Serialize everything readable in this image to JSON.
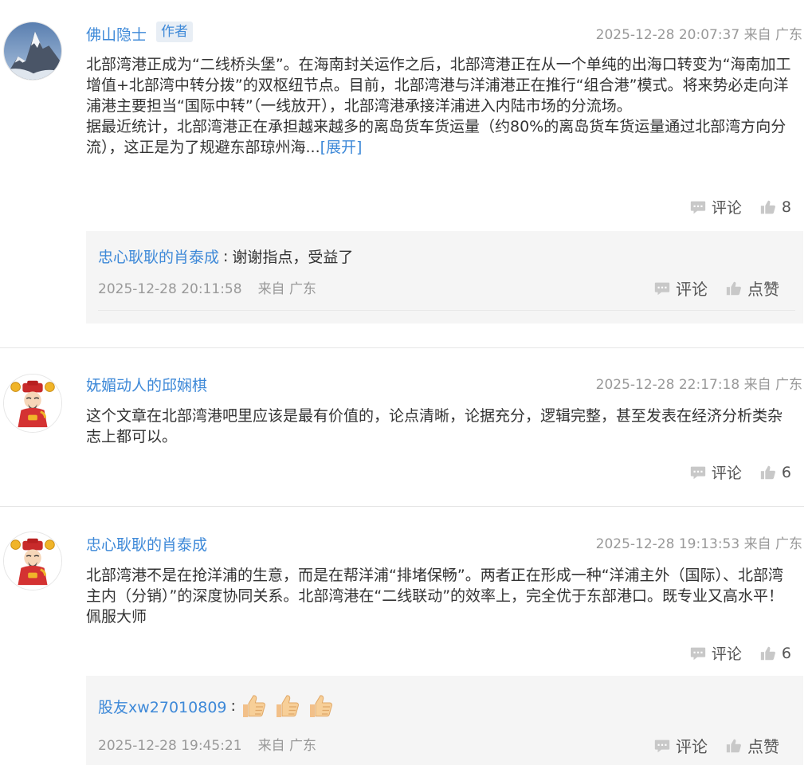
{
  "colors": {
    "link": "#3e89d8",
    "meta": "#999999",
    "reply_bg": "#f5f5f5",
    "icon_grey": "#c8c8c8"
  },
  "comments": [
    {
      "username": "佛山隐士",
      "badge": "作者",
      "timestamp": "2025-12-28 20:07:37 来自 广东",
      "body": "北部湾港正成为“二线桥头堡”。在海南封关运作之后，北部湾港正在从一个单纯的出海口转变为“海南加工增值+北部湾中转分拨”的双枢纽节点。目前，北部湾港与洋浦港正在推行“组合港”模式。将来势必走向洋浦港主要担当“国际中转”（一线放开），北部湾港承接洋浦进入内陆市场的分流场。\n据最近统计，北部湾港正在承担越来越多的离岛货车货运量（约80%的离岛货车货运量通过北部湾方向分流），这正是为了规避东部琼州海...",
      "expand_label": "[展开]",
      "comment_label": "评论",
      "like_count": "8",
      "avatar_icon": "mountain-avatar",
      "replies": [
        {
          "username": "忠心耿耿的肖泰成",
          "text": "谢谢指点，受益了",
          "time": "2025-12-28 20:11:58",
          "location": "来自 广东",
          "comment_label": "评论",
          "like_label": "点赞"
        }
      ]
    },
    {
      "username": "妩媚动人的邱娴棋",
      "timestamp": "2025-12-28 22:17:18 来自 广东",
      "body": "这个文章在北部湾港吧里应该是最有价值的，论点清晰，论据充分，逻辑完整，甚至发表在经济分析类杂志上都可以。",
      "comment_label": "评论",
      "like_count": "6",
      "avatar_icon": "caishen-avatar"
    },
    {
      "username": "忠心耿耿的肖泰成",
      "timestamp": "2025-12-28 19:13:53 来自 广东",
      "body": "北部湾港不是在抢洋浦的生意，而是在帮洋浦“排堵保畅”。两者正在形成一种“洋浦主外（国际）、北部湾主内（分销）”的深度协同关系。北部湾港在“二线联动”的效率上，完全优于东部港口。既专业又高水平！佩服大师",
      "comment_label": "评论",
      "like_count": "6",
      "avatar_icon": "caishen-avatar",
      "replies": [
        {
          "username": "股友xw27010809",
          "emoji": [
            "thumbs-up-emoji",
            "thumbs-up-emoji",
            "thumbs-up-emoji"
          ],
          "time": "2025-12-28 19:45:21",
          "location": "来自 广东",
          "comment_label": "评论",
          "like_label": "点赞"
        }
      ]
    }
  ]
}
